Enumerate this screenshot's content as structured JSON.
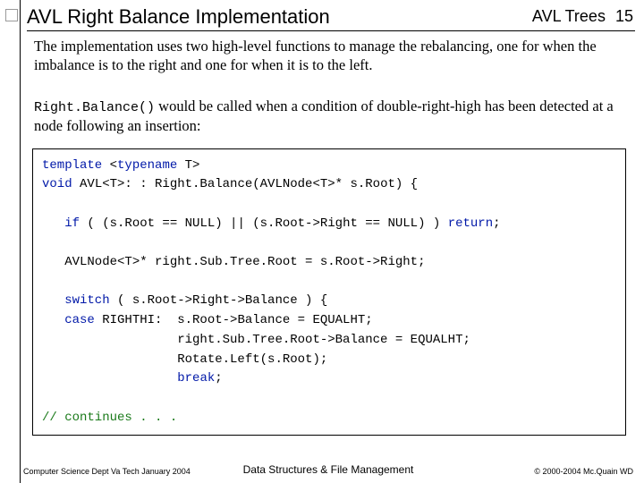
{
  "header": {
    "title": "AVL Right Balance Implementation",
    "topic": "AVL Trees",
    "page_num": "15"
  },
  "body": {
    "para1": "The implementation uses two high-level functions to manage the rebalancing, one for when the imbalance is to the right and one for when it is to the left.",
    "func_name": "Right.Balance()",
    "para2_rest": " would be called when a condition of double-right-high has been detected at a node following an insertion:",
    "code": {
      "l01a": "template",
      "l01b": " <",
      "l01c": "typename",
      "l01d": " T>",
      "l02a": "void",
      "l02b": " AVL<T>: : Right.Balance(AVLNode<T>* s.Root) {",
      "l03": "",
      "l04a": "   if",
      "l04b": " ( (s.Root == NULL) || (s.Root->Right == NULL) ) ",
      "l04c": "return",
      "l04d": ";",
      "l05": "",
      "l06": "   AVLNode<T>* right.Sub.Tree.Root = s.Root->Right;",
      "l07": "",
      "l08a": "   switch",
      "l08b": " ( s.Root->Right->Balance ) {",
      "l09a": "   case",
      "l09b": " RIGHTHI:  s.Root->Balance = EQUALHT;",
      "l10": "                  right.Sub.Tree.Root->Balance = EQUALHT;",
      "l11": "                  Rotate.Left(s.Root);",
      "l12a": "                  ",
      "l12b": "break",
      "l12c": ";",
      "l13": "",
      "l14": "// continues . . ."
    }
  },
  "footer": {
    "left": "Computer Science Dept Va Tech January 2004",
    "center": "Data Structures & File Management",
    "right": "© 2000-2004 Mc.Quain WD"
  }
}
